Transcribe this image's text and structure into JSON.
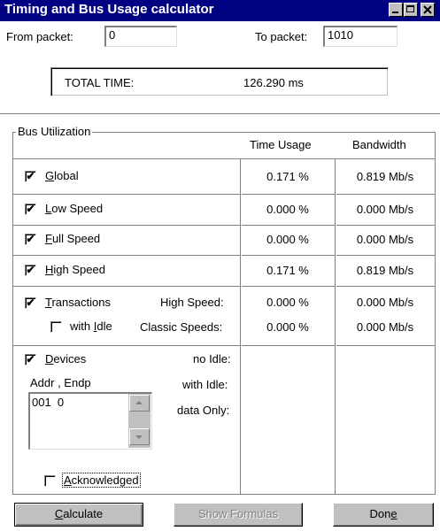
{
  "window": {
    "title": "Timing and Bus Usage calculator"
  },
  "range": {
    "from_label": "From packet:",
    "from_value": "0",
    "to_label": "To packet:",
    "to_value": "1010"
  },
  "total": {
    "label": "TOTAL TIME:",
    "value": "126.290 ms"
  },
  "bus": {
    "group_title": "Bus Utilization",
    "col_time": "Time Usage",
    "col_bandwidth": "Bandwidth",
    "rows": [
      {
        "label_first": "G",
        "label_rest": "lobal",
        "checked": "✔",
        "time": "0.171 %",
        "bandwidth": "0.819 Mb/s"
      },
      {
        "label_first": "L",
        "label_rest": "ow Speed",
        "checked": "✔",
        "time": "0.000 %",
        "bandwidth": "0.000 Mb/s"
      },
      {
        "label_first": "F",
        "label_rest": "ull Speed",
        "checked": "✔",
        "time": "0.000 %",
        "bandwidth": "0.000 Mb/s"
      },
      {
        "label_first": "H",
        "label_rest": "igh Speed",
        "checked": "✔",
        "time": "0.171 %",
        "bandwidth": "0.819 Mb/s"
      }
    ],
    "transactions": {
      "label_first": "T",
      "label_rest": "ransactions",
      "checked": "✔",
      "with_idle_prefix": "with ",
      "with_idle_u": "I",
      "with_idle_rest": "dle",
      "with_idle_checked": "",
      "high_label": "High Speed:",
      "high_time": "0.000 %",
      "high_bandwidth": "0.000 Mb/s",
      "classic_label": "Classic Speeds:",
      "classic_time": "0.000 %",
      "classic_bandwidth": "0.000 Mb/s"
    },
    "devices": {
      "label_first": "D",
      "label_rest": "evices",
      "checked": "✔",
      "addr_label": "Addr , Endp",
      "list_items": [
        "001  0"
      ],
      "no_idle_label": "no Idle:",
      "with_idle_label": "with Idle:",
      "data_only_label": "data Only:",
      "ack_first": "A",
      "ack_rest": "cknowledged",
      "ack_checked": ""
    }
  },
  "buttons": {
    "calculate_u": "C",
    "calculate_rest": "alculate",
    "show_formulas": "Show Formulas",
    "done_prefix": "Don",
    "done_u": "e"
  }
}
